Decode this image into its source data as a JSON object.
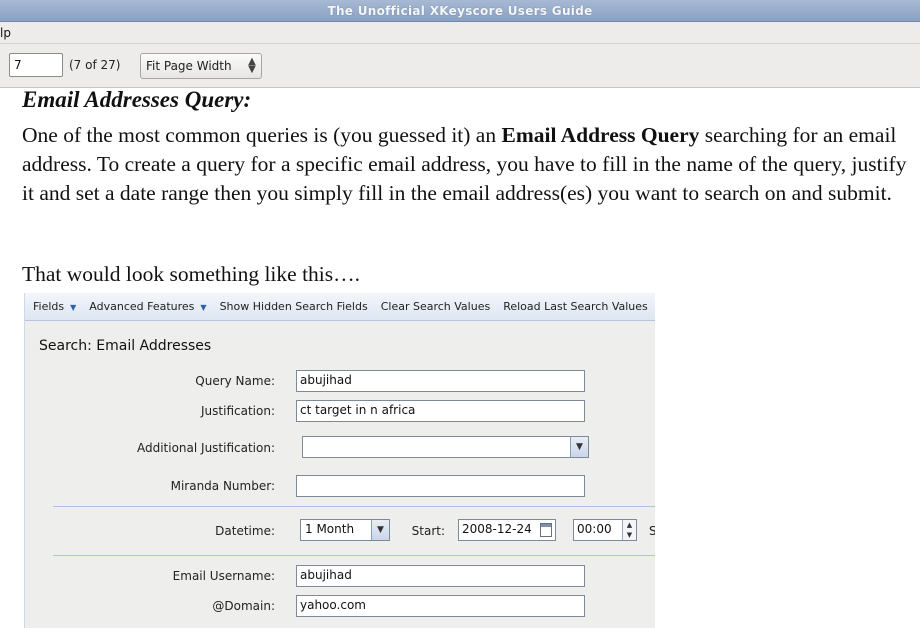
{
  "window": {
    "title": "The Unofficial XKeyscore Users Guide"
  },
  "menubar": {
    "partial_item": "lp"
  },
  "toolbar": {
    "page_value": "7",
    "page_count": "(7 of 27)",
    "zoom_selected": "Fit Page Width"
  },
  "document": {
    "heading": "Email Addresses Query:",
    "para_a": "One of the most common queries is (you guessed it) an ",
    "para_bold": "Email Address Query",
    "para_b": " searching for an email address. To create a query for a specific email address, you have to fill in the name of the query, justify it and set a date range then you simply fill in the email address(es) you want to search on and submit.",
    "para2": "That would look something like this…."
  },
  "screenshot": {
    "toolbar": {
      "fields": "Fields",
      "advanced": "Advanced Features",
      "show_hidden": "Show Hidden Search Fields",
      "clear": "Clear Search Values",
      "reload": "Reload Last Search Values"
    },
    "section_title": "Search: Email Addresses",
    "form": {
      "query_name_label": "Query Name:",
      "query_name_value": "abujihad",
      "justification_label": "Justification:",
      "justification_value": "ct target in n africa",
      "additional_label": "Additional Justification:",
      "additional_value": "",
      "miranda_label": "Miranda Number:",
      "miranda_value": "",
      "datetime_label": "Datetime:",
      "datetime_value": "1 Month",
      "start_label": "Start:",
      "start_date": "2008-12-24",
      "start_time": "00:00",
      "cut_char": "S",
      "email_user_label": "Email Username:",
      "email_user_value": "abujihad",
      "domain_label": "@Domain:",
      "domain_value": "yahoo.com"
    }
  }
}
